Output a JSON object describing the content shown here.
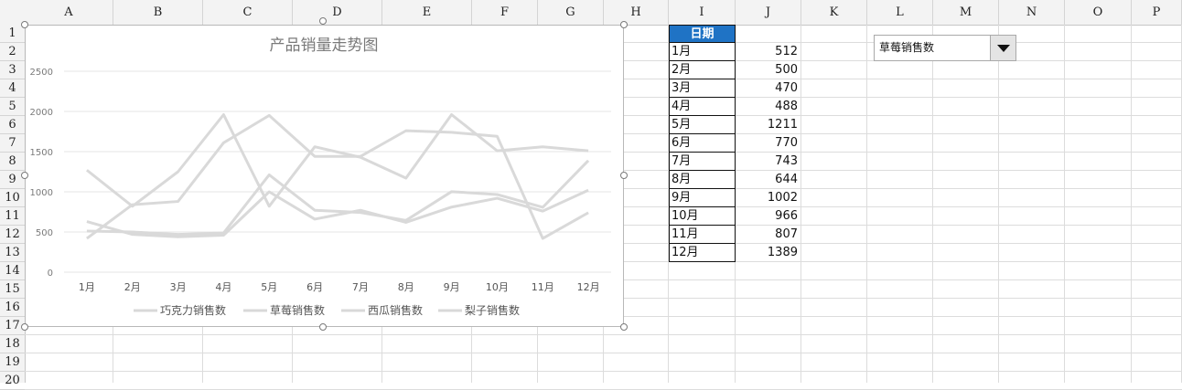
{
  "columns": [
    "A",
    "B",
    "C",
    "D",
    "E",
    "F",
    "G",
    "H",
    "I",
    "J",
    "K",
    "L",
    "M",
    "N",
    "O",
    "P"
  ],
  "rows": [
    "1",
    "2",
    "3",
    "4",
    "5",
    "6",
    "7",
    "8",
    "9",
    "10",
    "11",
    "12",
    "13",
    "14",
    "15",
    "16",
    "17",
    "18",
    "19",
    "20"
  ],
  "table": {
    "header": "日期",
    "months": [
      "1月",
      "2月",
      "3月",
      "4月",
      "5月",
      "6月",
      "7月",
      "8月",
      "9月",
      "10月",
      "11月",
      "12月"
    ],
    "values": [
      "512",
      "500",
      "470",
      "488",
      "1211",
      "770",
      "743",
      "644",
      "1002",
      "966",
      "807",
      "1389"
    ]
  },
  "combo": {
    "selected": "草莓销售数"
  },
  "chart_data": {
    "type": "line",
    "title": "产品销量走势图",
    "categories": [
      "1月",
      "2月",
      "3月",
      "4月",
      "5月",
      "6月",
      "7月",
      "8月",
      "9月",
      "10月",
      "11月",
      "12月"
    ],
    "ylim": [
      0,
      2500
    ],
    "yticks": [
      "0",
      "500",
      "1000",
      "1500",
      "2000",
      "2500"
    ],
    "legend_position": "bottom",
    "grid": true,
    "line_color": "#d9d9d9",
    "series": [
      {
        "name": "巧克力销售数",
        "values": [
          1270,
          820,
          1250,
          1960,
          820,
          1560,
          1430,
          1170,
          1960,
          1510,
          1560,
          1510
        ]
      },
      {
        "name": "草莓销售数",
        "values": [
          512,
          500,
          470,
          488,
          1211,
          770,
          743,
          644,
          1002,
          966,
          807,
          1389
        ]
      },
      {
        "name": "西瓜销售数",
        "values": [
          420,
          840,
          880,
          1610,
          1950,
          1440,
          1440,
          1760,
          1740,
          1690,
          420,
          740
        ]
      },
      {
        "name": "梨子销售数",
        "values": [
          630,
          470,
          440,
          460,
          1000,
          660,
          770,
          620,
          810,
          920,
          760,
          1020
        ]
      }
    ]
  }
}
